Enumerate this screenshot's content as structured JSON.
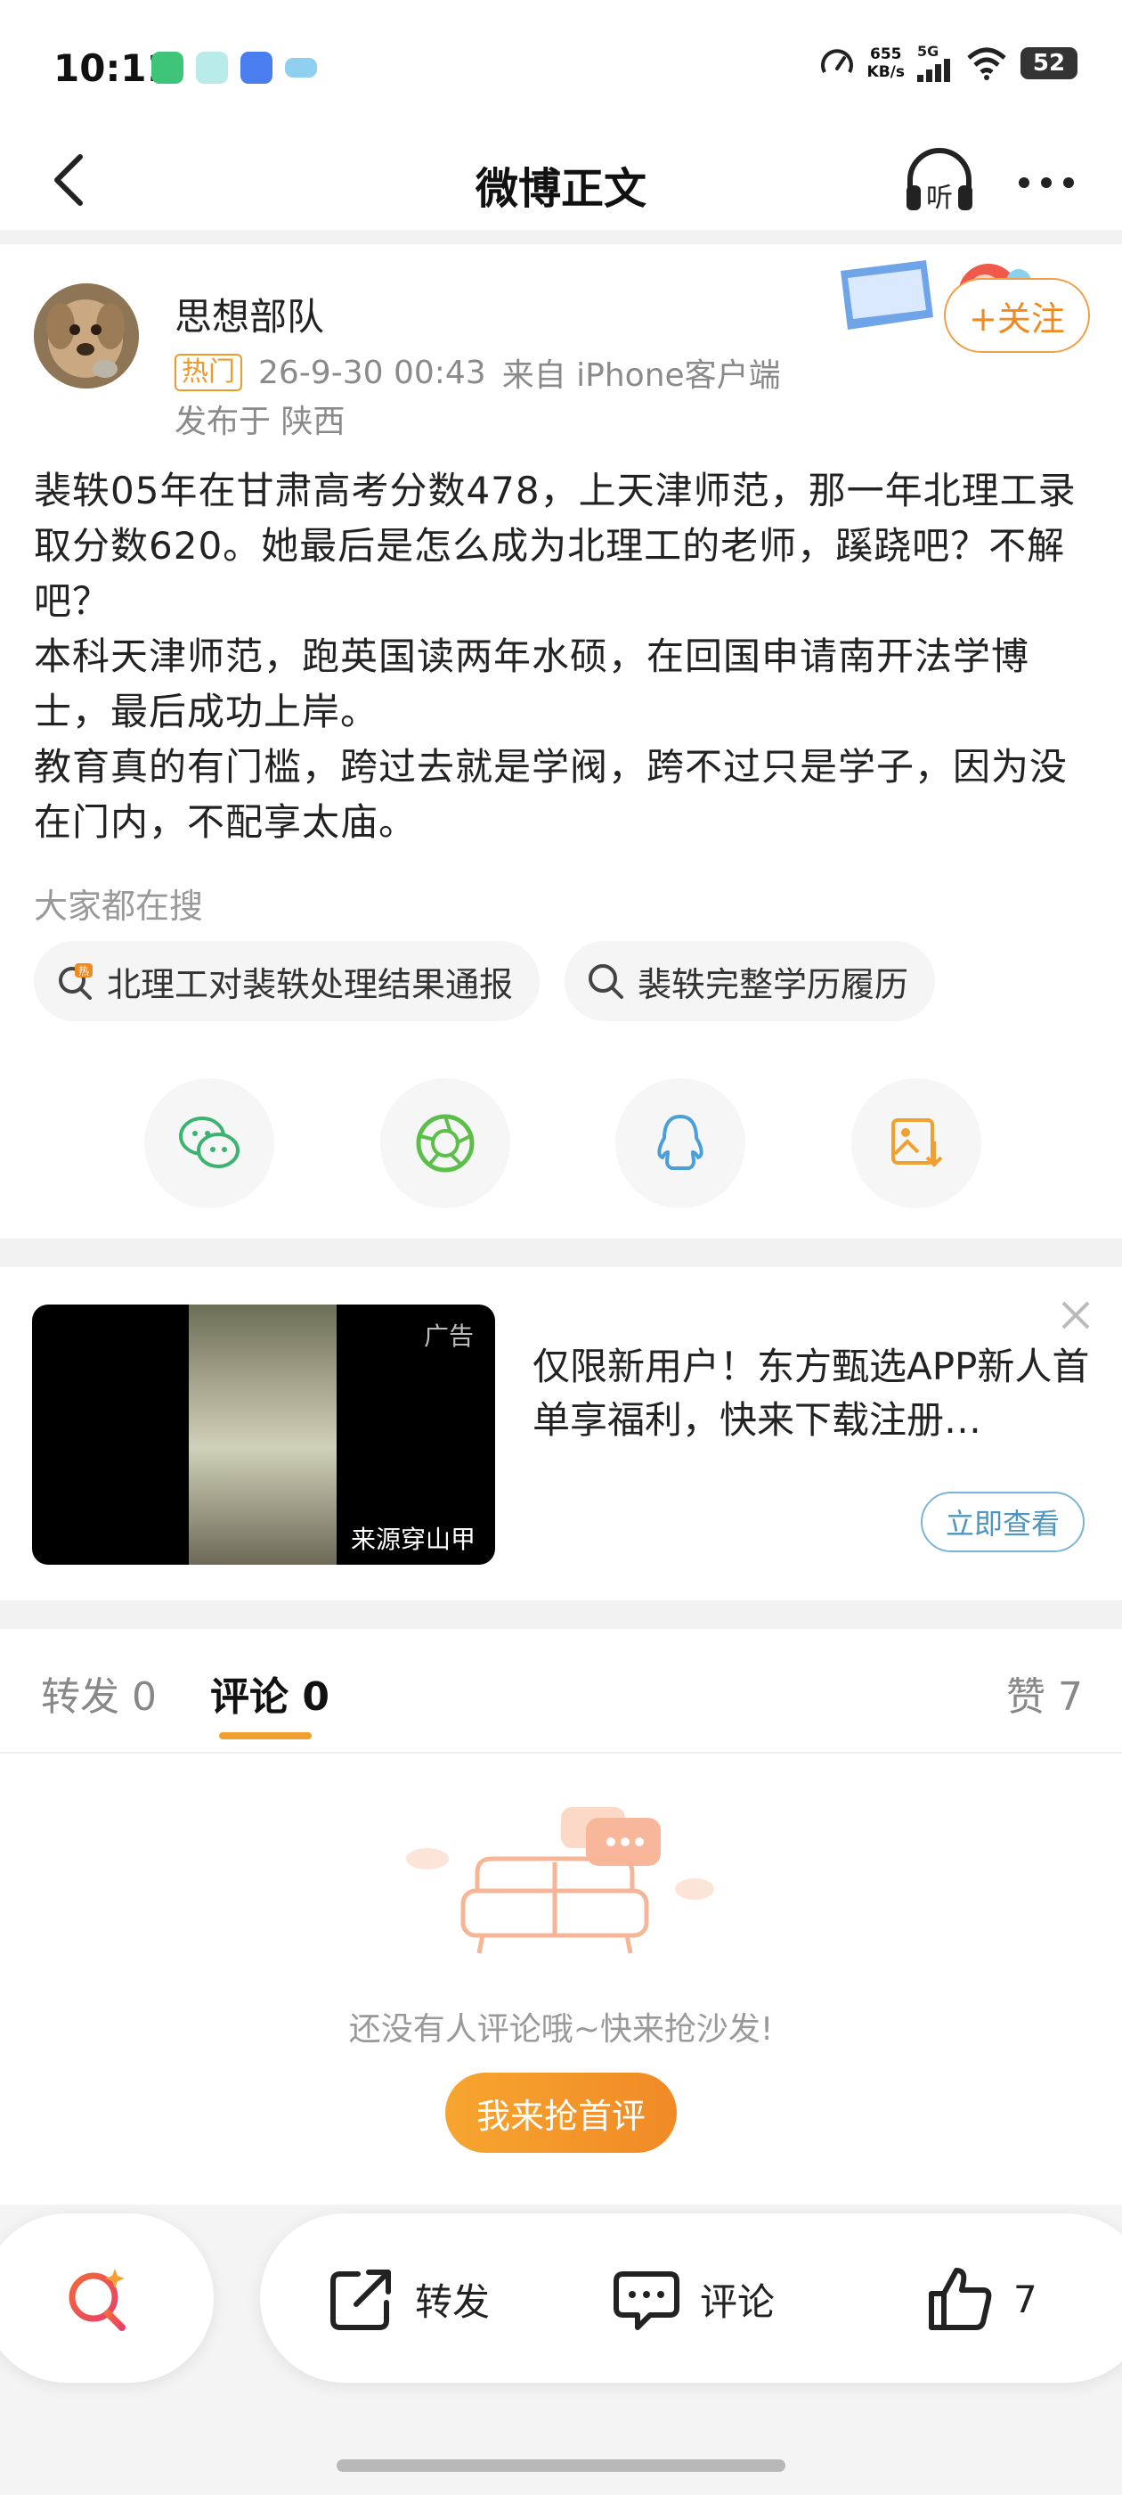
{
  "status_bar": {
    "time": "10:11",
    "net_speed_value": "655",
    "net_speed_unit": "KB/s",
    "signal_label": "5G",
    "battery": "52"
  },
  "nav": {
    "title": "微博正文",
    "listen_label": "听"
  },
  "post": {
    "author": "思想部队",
    "hot_badge": "热门",
    "timestamp": "26-9-30 00:43",
    "source": "来自 iPhone客户端",
    "location": "发布于 陕西",
    "follow_label": "+关注",
    "paragraphs": [
      "裴轶05年在甘肃高考分数478，上天津师范，那一年北理工录取分数620。她最后是怎么成为北理工的老师，蹊跷吧？不解吧？",
      "本科天津师范，跑英国读两年水硕，在回国申请南开法学博士，最后成功上岸。",
      "教育真的有门槛，跨过去就是学阀，跨不过只是学子，因为没在门内，不配享太庙。"
    ]
  },
  "search": {
    "heading": "大家都在搜",
    "chips": [
      {
        "label": "北理工对裴轶处理结果通报",
        "icon": "hot-search-icon",
        "hot_mark": "热"
      },
      {
        "label": "裴轶完整学历履历",
        "icon": "search-icon"
      }
    ]
  },
  "share": [
    {
      "name": "wechat",
      "icon": "wechat-icon",
      "color": "#3cb371"
    },
    {
      "name": "moments",
      "icon": "moments-icon",
      "color": "#5cbf4a"
    },
    {
      "name": "qq",
      "icon": "qq-icon",
      "color": "#4a9fd8"
    },
    {
      "name": "save-image",
      "icon": "save-image-icon",
      "color": "#f0a030"
    }
  ],
  "ad": {
    "tag": "广告",
    "source": "来源穿山甲",
    "text": "仅限新用户！东方甄选APP新人首单享福利，快来下载注册…",
    "button": "立即查看"
  },
  "tabs": {
    "repost": "转发 0",
    "comment": "评论 0",
    "like": "赞 7"
  },
  "empty": {
    "message": "还没有人评论哦~快来抢沙发!",
    "button": "我来抢首评"
  },
  "action_bar": {
    "repost": "转发",
    "comment": "评论",
    "like_count": "7"
  },
  "colors": {
    "accent": "#f08a20",
    "link_blue": "#4e95bf",
    "hot_badge": "#ee9a2a"
  }
}
